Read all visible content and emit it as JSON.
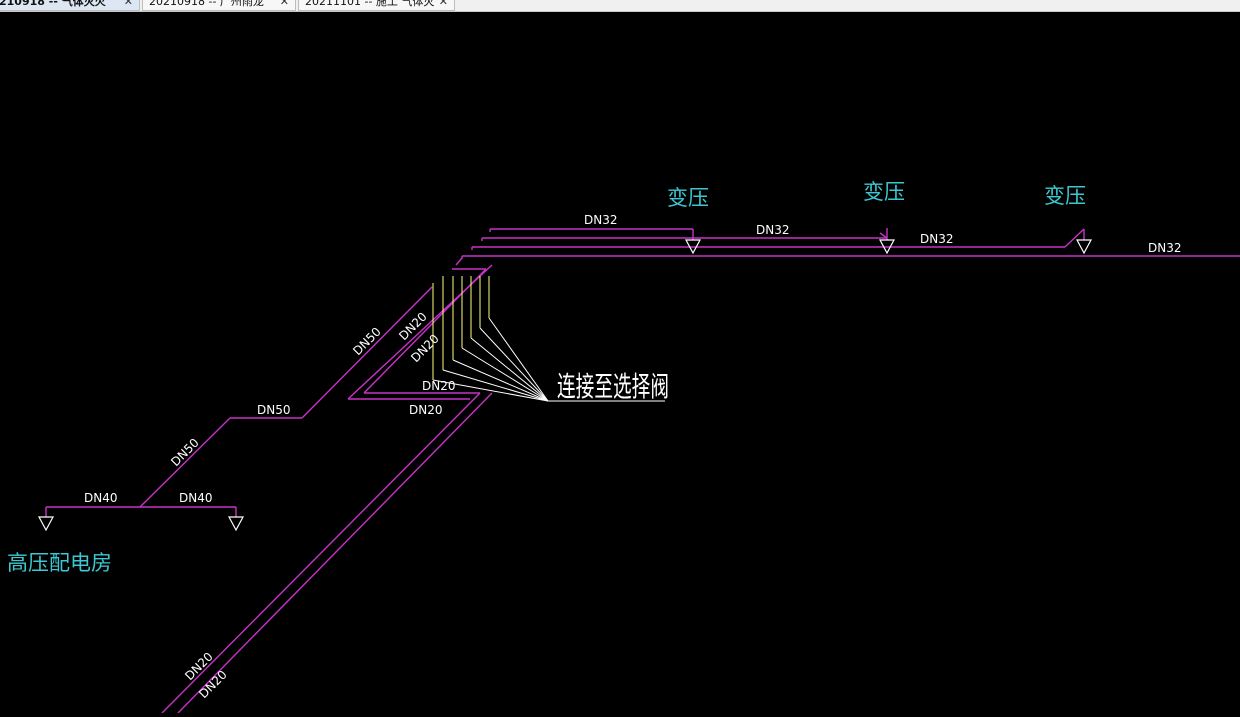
{
  "tabs": [
    {
      "label": "210918 -- 气体灭火",
      "active": true
    },
    {
      "label": "20210918 -- 广州雨龙",
      "active": false
    },
    {
      "label": "20211101 -- 施工 气体灭",
      "active": false
    }
  ],
  "drawing": {
    "room_high_voltage": "高压配电房",
    "room_transformer_1": "变压",
    "room_transformer_2": "变压",
    "room_transformer_3": "变压",
    "connect_note": "连接至选择阀",
    "pipe_labels": {
      "dn32_1": "DN32",
      "dn32_2": "DN32",
      "dn32_3": "DN32",
      "dn32_4": "DN32",
      "dn50_diag_upper": "DN50",
      "dn50_horizontal": "DN50",
      "dn50_diag_lower": "DN50",
      "dn40_left": "DN40",
      "dn40_right": "DN40",
      "dn20_a": "DN20",
      "dn20_b": "DN20",
      "dn20_c": "DN20",
      "dn20_d": "DN20",
      "dn20_e": "DN20",
      "dn20_f": "DN20"
    }
  },
  "colors": {
    "pipe": "#c832c8",
    "label": "#ffffff",
    "room_text": "#3cc8d2",
    "riser": "#ffff78",
    "canvas_bg": "#000000"
  }
}
